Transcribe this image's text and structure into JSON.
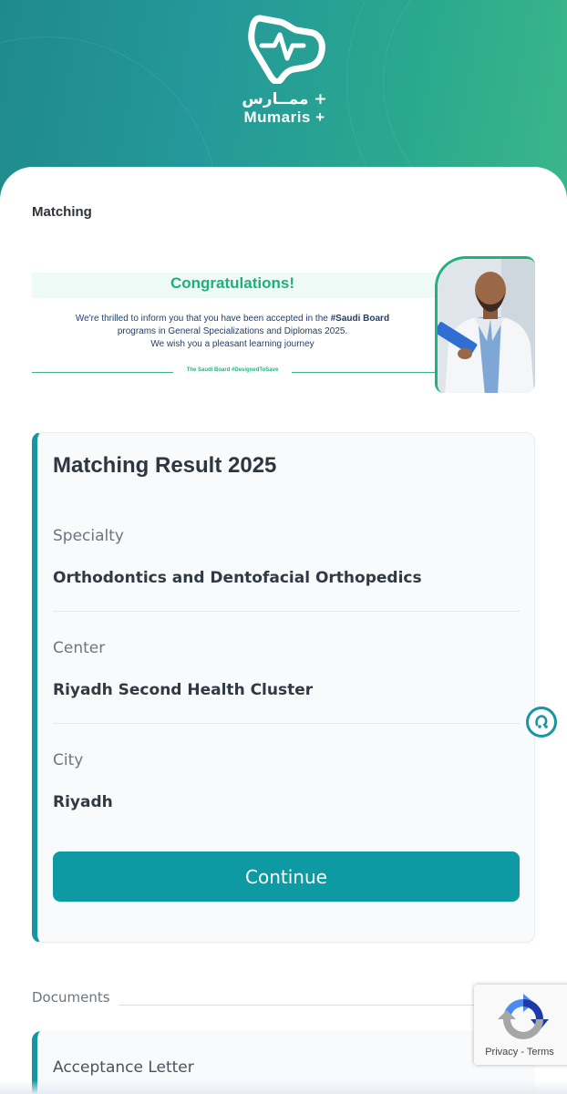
{
  "brand": {
    "name_ar": "ممــارس +",
    "name_en": "Mumaris +",
    "colors": {
      "primary": "#0e9aa3",
      "accent_green": "#1fb07a",
      "header_gradient_start": "#1f8a8c",
      "header_gradient_end": "#3ab789"
    }
  },
  "page": {
    "section_title": "Matching"
  },
  "banner": {
    "heading": "Congratulations!",
    "line1_prefix": "We're thrilled to inform you that you have been accepted in the ",
    "line1_bold": "#Saudi Board",
    "line2": "programs in General Specializations and Diplomas 2025.",
    "line3": "We wish you a pleasant learning journey",
    "footer_tag": "The Saudi Board #DesignedToSave",
    "image": "doctor-holding-clipboard-photo"
  },
  "result": {
    "title": "Matching Result 2025",
    "fields": [
      {
        "label": "Specialty",
        "value": "Orthodontics and Dentofacial Orthopedics"
      },
      {
        "label": "Center",
        "value": "Riyadh Second Health Cluster"
      },
      {
        "label": "City",
        "value": "Riyadh"
      }
    ],
    "continue_label": "Continue"
  },
  "help": {
    "icon": "chat-help-icon"
  },
  "documents": {
    "label": "Documents",
    "items": [
      {
        "title": "Acceptance Letter"
      }
    ]
  },
  "recaptcha": {
    "privacy": "Privacy",
    "separator": " - ",
    "terms": "Terms",
    "icon": "recaptcha-logo-icon"
  }
}
